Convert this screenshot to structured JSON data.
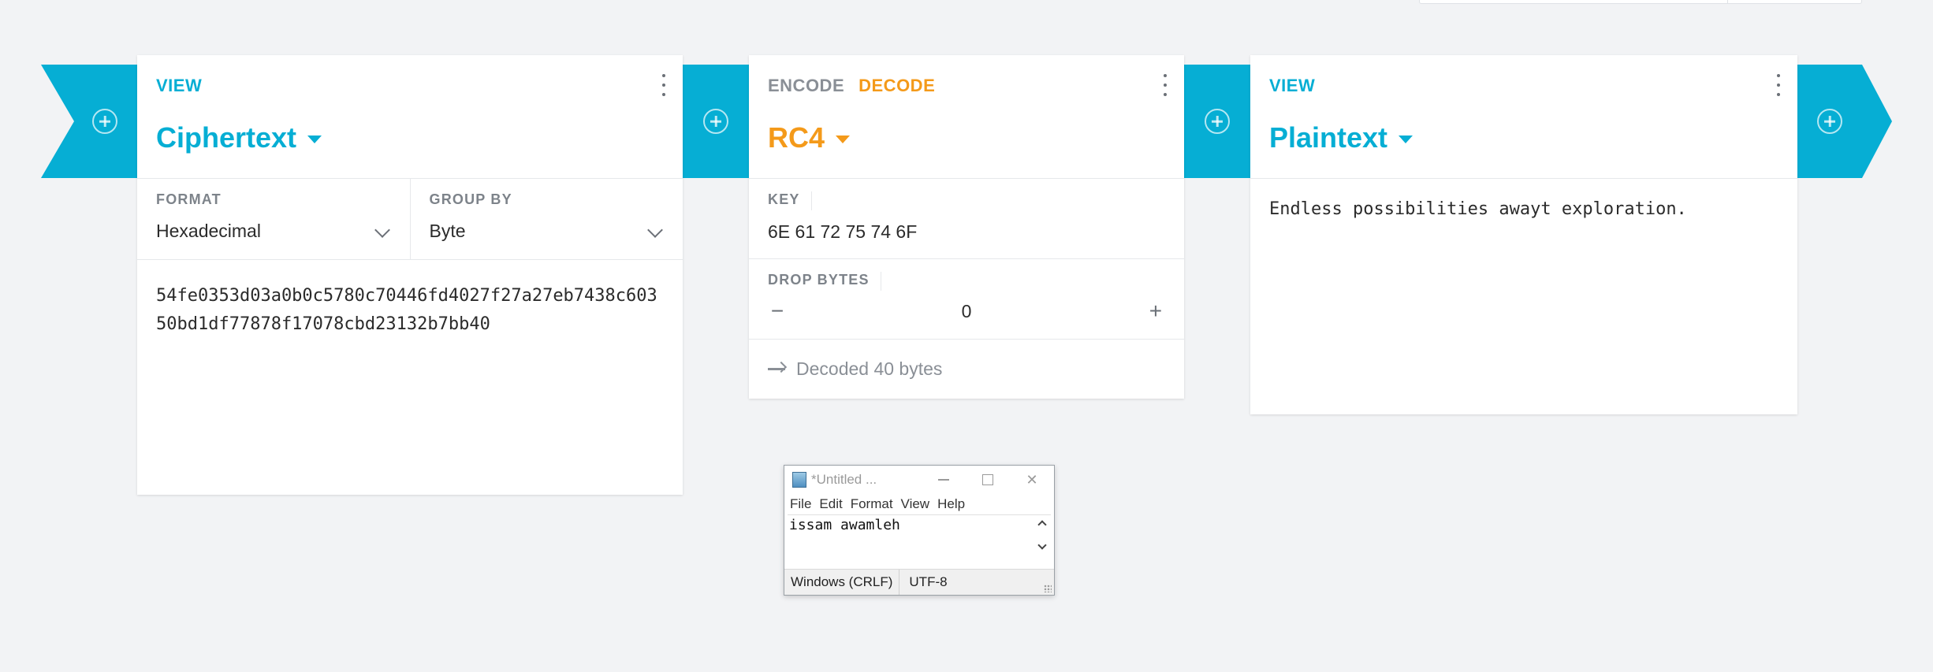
{
  "pipeline": {
    "add_icon": "plus-circle-icon"
  },
  "card_view_ciphertext": {
    "mode_tab": "VIEW",
    "title": "Ciphertext",
    "format_label": "FORMAT",
    "format_value": "Hexadecimal",
    "group_label": "GROUP BY",
    "group_value": "Byte",
    "content": "54fe0353d03a0b0c5780c70446fd4027f27a27eb7438c60350bd1df77878f17078cbd23132b7bb40"
  },
  "card_rc4": {
    "tab_encode": "ENCODE",
    "tab_decode": "DECODE",
    "title": "RC4",
    "key_label": "KEY",
    "key_value": "6E 61 72 75 74 6F",
    "drop_label": "DROP BYTES",
    "drop_value": "0",
    "decrement": "−",
    "increment": "+",
    "status": "Decoded 40 bytes"
  },
  "card_view_plaintext": {
    "mode_tab": "VIEW",
    "title": "Plaintext",
    "content": "Endless possibilities awayt exploration."
  },
  "notepad": {
    "title": "*Untitled ...",
    "menu": [
      "File",
      "Edit",
      "Format",
      "View",
      "Help"
    ],
    "content": "issam awamleh",
    "status_line_ending": "Windows (CRLF)",
    "status_encoding": "UTF-8",
    "close_glyph": "✕"
  },
  "colors": {
    "accent_blue": "#06aed4",
    "accent_orange": "#f49a1a",
    "background": "#f2f3f5"
  }
}
